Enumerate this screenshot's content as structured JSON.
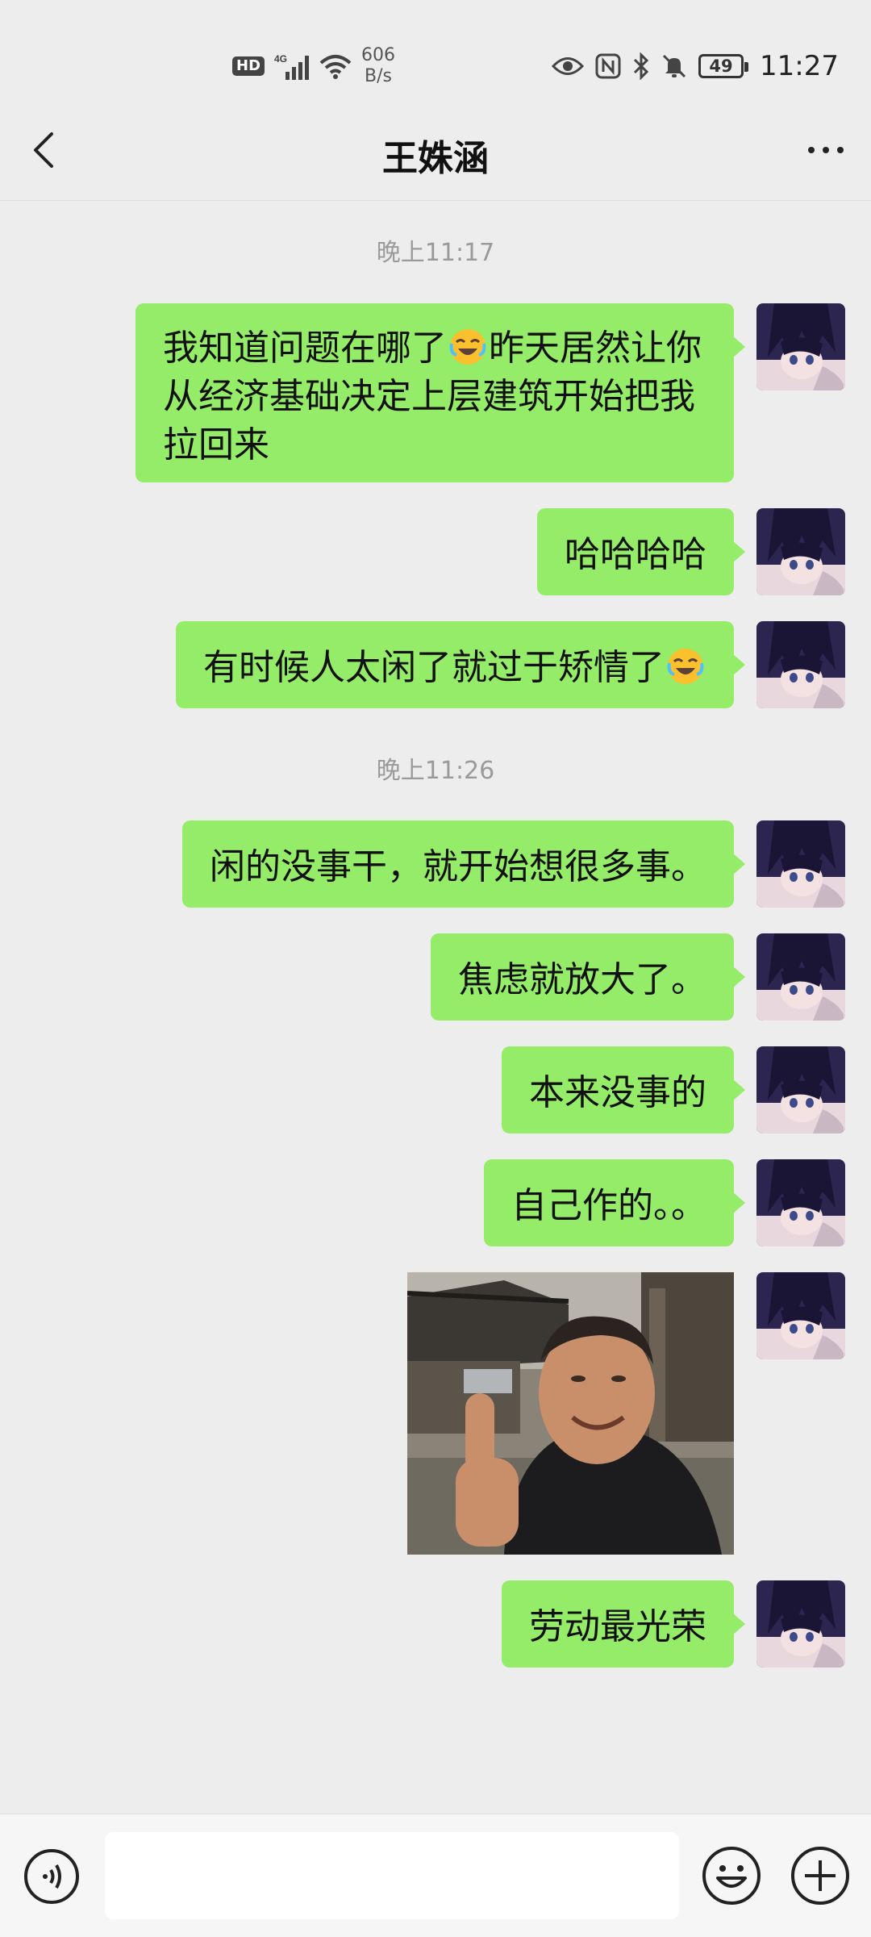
{
  "status_bar": {
    "hd_badge": "HD",
    "network": "4G",
    "net_speed_value": "606",
    "net_speed_unit": "B/s",
    "battery": "49",
    "time": "11:27",
    "icons": [
      "eye-icon",
      "nfc-icon",
      "bluetooth-icon",
      "mute-bell-icon"
    ]
  },
  "nav": {
    "title": "王姝涵",
    "back_icon": "chevron-left-icon",
    "more_icon": "more-dots-icon"
  },
  "chat": {
    "timestamps": [
      "晚上11:17",
      "晚上11:26"
    ],
    "messages": [
      {
        "line1_pre": "我知道问题在哪了",
        "line1_post": "昨天居然让你",
        "line2": "从经济基础决定上层建筑开始把我",
        "line3": "拉回来",
        "emoji": "grinning-sweat-tears"
      },
      {
        "text": "哈哈哈哈"
      },
      {
        "text": "有时候人太闲了就过于矫情了",
        "emoji": "grinning-sweat-tears"
      },
      {
        "text": "闲的没事干，就开始想很多事。"
      },
      {
        "text": "焦虑就放大了。"
      },
      {
        "text": "本来没事的"
      },
      {
        "text": "自己作的。。"
      },
      {
        "image": "thumbs-up-man-photo"
      },
      {
        "text": "劳动最光荣"
      }
    ]
  },
  "input_bar": {
    "voice_icon": "voice-icon",
    "emoji_icon": "smiley-icon",
    "plus_icon": "plus-icon",
    "placeholder": ""
  },
  "colors": {
    "background": "#ededed",
    "bubble": "#95ec69",
    "timestamp": "#9a9a9a"
  }
}
